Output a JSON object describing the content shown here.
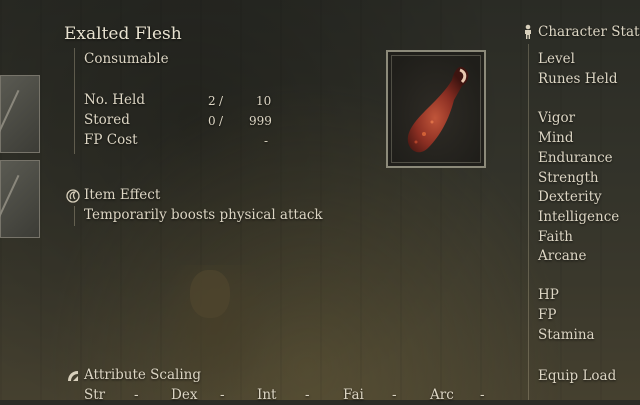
{
  "item": {
    "name": "Exalted Flesh",
    "category": "Consumable",
    "held_label": "No. Held",
    "held_value": "2",
    "held_max": "10",
    "stored_label": "Stored",
    "stored_value": "0",
    "stored_max": "999",
    "fp_label": "FP Cost",
    "fp_value": "-",
    "slash": "/"
  },
  "effect": {
    "heading": "Item Effect",
    "text": "Temporarily boosts physical attack"
  },
  "scaling": {
    "heading": "Attribute Scaling",
    "items": [
      {
        "label": "Str",
        "value": "-"
      },
      {
        "label": "Dex",
        "value": "-"
      },
      {
        "label": "Int",
        "value": "-"
      },
      {
        "label": "Fai",
        "value": "-"
      },
      {
        "label": "Arc",
        "value": "-"
      }
    ]
  },
  "status": {
    "heading": "Character Status",
    "level": "Level",
    "runes": "Runes Held",
    "attrs": [
      "Vigor",
      "Mind",
      "Endurance",
      "Strength",
      "Dexterity",
      "Intelligence",
      "Faith",
      "Arcane"
    ],
    "hp": "HP",
    "fp": "FP",
    "stamina": "Stamina",
    "equip_load": "Equip Load"
  }
}
